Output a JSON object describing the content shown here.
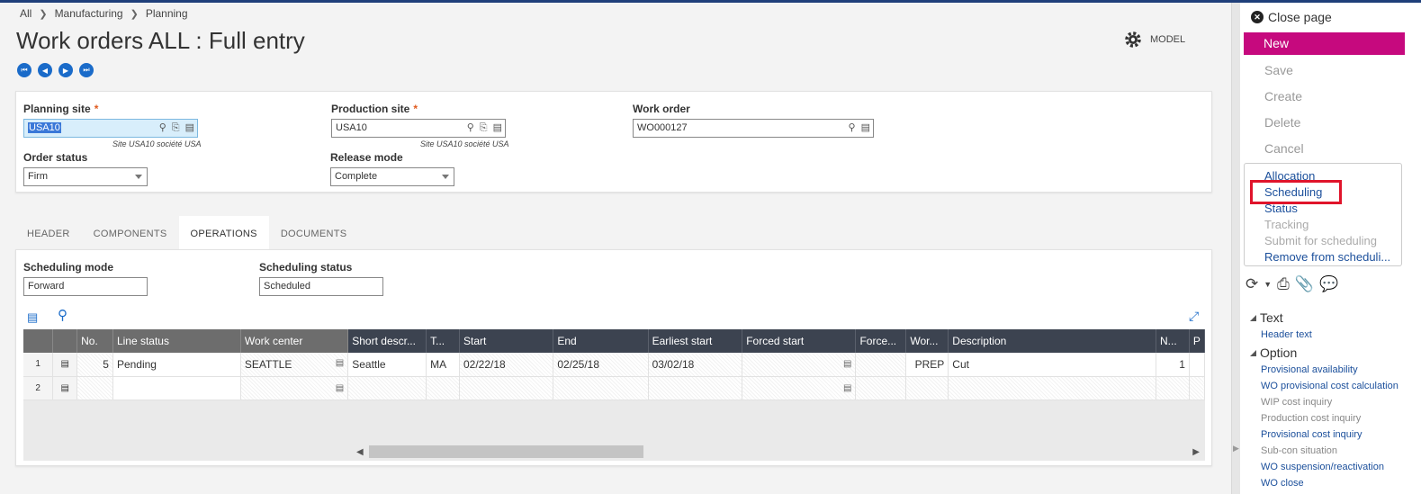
{
  "breadcrumb": {
    "items": [
      "All",
      "Manufacturing",
      "Planning"
    ]
  },
  "page": {
    "title": "Work orders ALL : Full entry",
    "model_label": "MODEL"
  },
  "form": {
    "planning_site": {
      "label": "Planning site",
      "value": "USA10",
      "hint": "Site USA10 société USA"
    },
    "production_site": {
      "label": "Production site",
      "value": "USA10",
      "hint": "Site USA10 société USA"
    },
    "work_order": {
      "label": "Work order",
      "value": "WO000127"
    },
    "order_status": {
      "label": "Order status",
      "value": "Firm"
    },
    "release_mode": {
      "label": "Release mode",
      "value": "Complete"
    }
  },
  "tabs": [
    "HEADER",
    "COMPONENTS",
    "OPERATIONS",
    "DOCUMENTS"
  ],
  "operations": {
    "scheduling_mode": {
      "label": "Scheduling mode",
      "value": "Forward"
    },
    "scheduling_status": {
      "label": "Scheduling status",
      "value": "Scheduled"
    },
    "grid": {
      "columns": [
        "No.",
        "Line status",
        "Work center",
        "Short descr...",
        "T...",
        "Start",
        "End",
        "Earliest start",
        "Forced start",
        "Force...",
        "Wor...",
        "Description",
        "N...",
        "P"
      ],
      "rows": [
        {
          "rownum": "1",
          "no": "5",
          "line_status": "Pending",
          "work_center": "SEATTLE",
          "short_descr": "Seattle",
          "t": "MA",
          "start": "02/22/18",
          "end": "02/25/18",
          "earliest_start": "03/02/18",
          "forced_start": "",
          "forced_end": "",
          "work": "PREP",
          "description": "Cut",
          "n": "1"
        },
        {
          "rownum": "2",
          "no": "",
          "line_status": "",
          "work_center": "",
          "short_descr": "",
          "t": "",
          "start": "",
          "end": "",
          "earliest_start": "",
          "forced_start": "",
          "forced_end": "",
          "work": "",
          "description": "",
          "n": ""
        }
      ]
    }
  },
  "sidebar": {
    "close_label": "Close page",
    "new_label": "New",
    "actions": [
      "Save",
      "Create",
      "Delete",
      "Cancel"
    ],
    "functions": [
      "Allocation",
      "Scheduling",
      "Status",
      "Tracking",
      "Submit for scheduling",
      "Remove from scheduli..."
    ],
    "text_section": {
      "title": "Text",
      "links": [
        "Header text"
      ]
    },
    "option_section": {
      "title": "Option",
      "links": [
        "Provisional availability",
        "WO provisional cost calculation",
        "WIP cost inquiry",
        "Production cost inquiry",
        "Provisional cost inquiry",
        "Sub-con situation",
        "WO suspension/reactivation",
        "WO close"
      ]
    }
  },
  "colors": {
    "accent": "#c6097e",
    "nav": "#1a6bc9",
    "highlight": "#e0142b",
    "link": "#1b4f9b"
  }
}
